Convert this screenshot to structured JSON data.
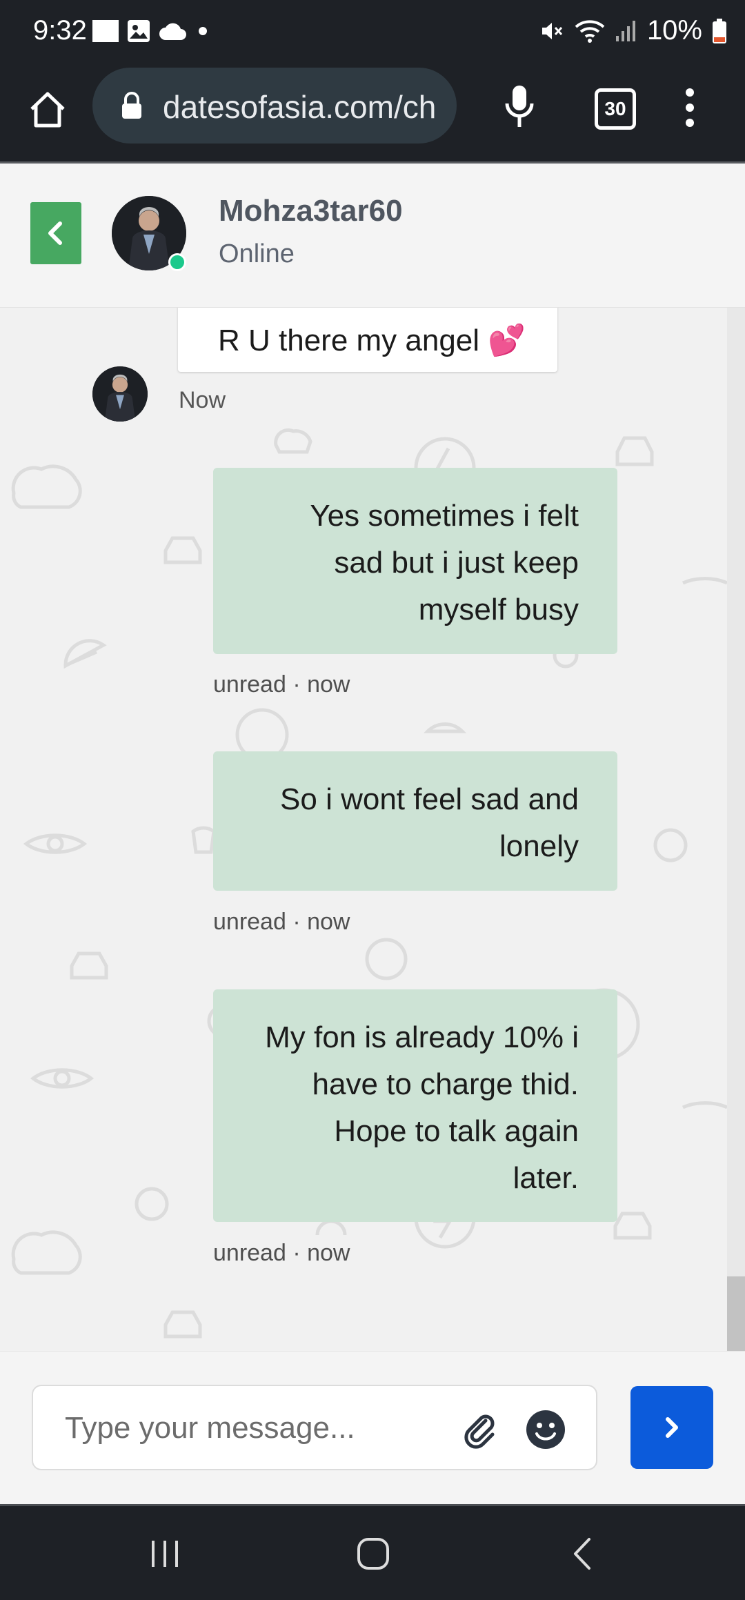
{
  "status_bar": {
    "time": "9:32",
    "battery": "10%",
    "icons": [
      "white-square-icon",
      "image-icon",
      "cloud-icon",
      "dot-icon",
      "mute-icon",
      "wifi-icon",
      "signal-icon",
      "battery-icon"
    ]
  },
  "browser": {
    "url": "datesofasia.com/ch",
    "tab_count": "30",
    "icons": [
      "home-icon",
      "lock-icon",
      "mic-icon",
      "tabs-icon",
      "more-vert-icon"
    ]
  },
  "chat_header": {
    "contact_name": "Mohza3tar60",
    "status": "Online",
    "colors": {
      "back_button": "#47a861",
      "online_dot": "#1cc98c"
    }
  },
  "messages": {
    "incoming": {
      "text": "R U there my angel 💕",
      "time": "Now"
    },
    "outgoing": [
      {
        "lines": [
          "Yes sometimes i felt",
          "sad but i just keep",
          "myself busy"
        ],
        "meta": "unread · now"
      },
      {
        "lines": [
          "So i wont feel sad and",
          "lonely"
        ],
        "meta": "unread · now"
      },
      {
        "lines": [
          "My fon is already 10% i",
          "have to charge thid.",
          "Hope to talk again",
          "later."
        ],
        "meta": "unread · now"
      }
    ],
    "colors": {
      "outgoing_bubble": "#cde3d5",
      "incoming_bubble": "#ffffff"
    }
  },
  "composer": {
    "placeholder": "Type your message...",
    "value": "",
    "colors": {
      "send_button": "#0c5bdb"
    }
  },
  "nav_bar": {
    "icons": [
      "recents-icon",
      "home-circle-icon",
      "back-icon"
    ]
  }
}
